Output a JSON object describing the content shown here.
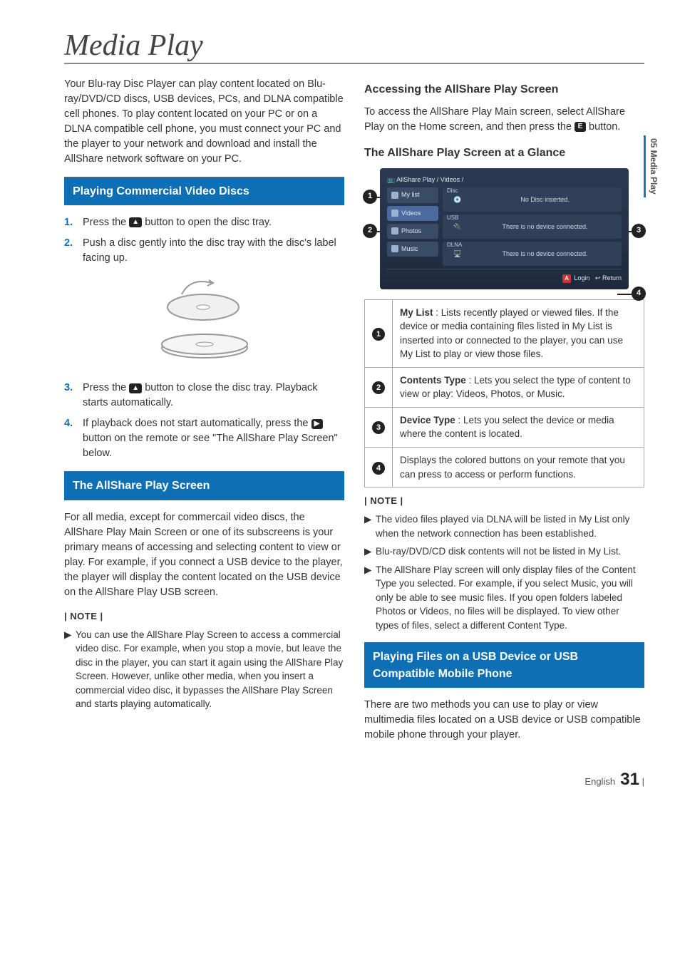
{
  "sideTab": "05  Media Play",
  "title": "Media Play",
  "intro": "Your Blu-ray Disc Player can play content located on Blu-ray/DVD/CD discs, USB devices, PCs, and DLNA compatible cell phones. To play content located on your PC or on a DLNA compatible cell phone, you must connect your PC and the player to your network and download and install the AllShare network software on your PC.",
  "sec1": {
    "title": "Playing Commercial Video Discs",
    "steps": {
      "n1": "1.",
      "t1a": "Press the ",
      "t1b": " button to open the disc tray.",
      "n2": "2.",
      "t2": "Push a disc gently into the disc tray with the disc's label facing up.",
      "n3": "3.",
      "t3a": "Press the ",
      "t3b": " button to close the disc tray. Playback starts automatically.",
      "n4": "4.",
      "t4a": "If playback does not start automatically, press the ",
      "t4b": " button on the remote or see \"The AllShare Play Screen\" below."
    }
  },
  "sec2": {
    "title": "The AllShare Play Screen",
    "body": "For all media, except for commercail video discs, the AllShare Play Main Screen or one of its subscreens is your primary means of accessing and selecting content to view or play. For example, if you connect a USB device to the player, the player will display the content located on the USB device on the AllShare Play USB screen.",
    "noteHead": "| NOTE |",
    "note1": "You can use the AllShare Play Screen to access a commercial video disc. For example, when you stop a movie, but leave the disc in the player, you can start it again using the AllShare Play Screen. However, unlike other media, when you insert a commercial video disc, it bypasses the AllShare Play Screen and starts playing automatically."
  },
  "right": {
    "h1": "Accessing the AllShare Play Screen",
    "p1a": "To access the AllShare Play Main screen, select AllShare Play on the Home screen, and then press the ",
    "p1b": " button.",
    "h2": "The AllShare Play Screen at a Glance",
    "screen": {
      "crumbs": "AllShare Play  / Videos /",
      "side": {
        "mylist": "My list",
        "videos": "Videos",
        "photos": "Photos",
        "music": "Music"
      },
      "disc": {
        "title": "Disc",
        "msg": "No Disc inserted."
      },
      "usb": {
        "title": "USB",
        "msg": "There is no device connected."
      },
      "dlna": {
        "title": "DLNA",
        "msg": "There is no device connected."
      },
      "footA": "A",
      "footLogin": "Login",
      "footReturn": "Return"
    },
    "legend": {
      "r1_bold": "My List",
      "r1": " : Lists recently played or viewed files. If the device or media containing files listed in My List is inserted into or connected to the player, you can use My List to play or view those files.",
      "r2_bold": "Contents Type",
      "r2": " : Lets you select the type of content to view or play: Videos, Photos, or Music.",
      "r3_bold": "Device Type",
      "r3": " : Lets you select the device or media where the content is located.",
      "r4": "Displays the colored buttons on your remote that you can press to access or perform functions."
    },
    "noteHead": "| NOTE |",
    "note1": "The video files played via DLNA will be listed in My List only when the network connection has been established.",
    "note2": "Blu-ray/DVD/CD disk contents will not be listed in My List.",
    "note3": "The AllShare Play screen will only display files of the Content Type you selected. For example, if you select Music, you will only be able to see music files. If you open folders labeled Photos or Videos, no files will be displayed. To view other types of files, select a different Content Type.",
    "sec3": "Playing Files on a USB Device or USB Compatible Mobile Phone",
    "sec3body": "There are two methods you can use to play or view multimedia files located on a USB device or USB compatible mobile phone through your player."
  },
  "footer": {
    "lang": "English",
    "page": "31"
  },
  "icons": {
    "eject": "▲",
    "play": "▶",
    "enter": "E",
    "returnArrow": "↩"
  }
}
